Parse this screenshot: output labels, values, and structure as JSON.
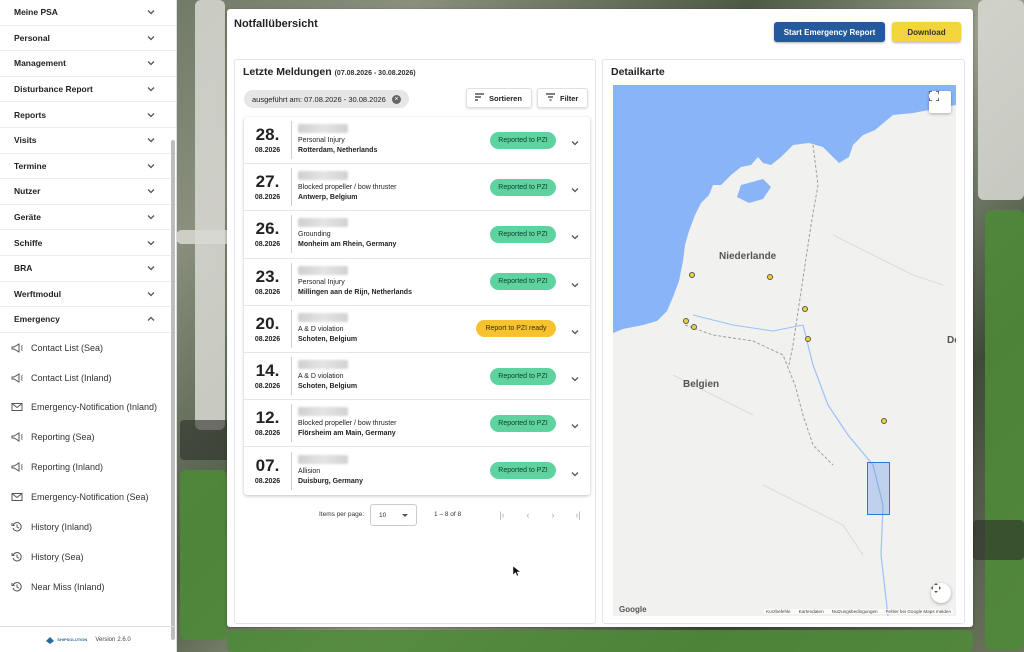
{
  "sidebar": {
    "sections": [
      {
        "label": "Meine PSA",
        "icon": "chevron-down-icon"
      },
      {
        "label": "Personal",
        "icon": "chevron-down-icon"
      },
      {
        "label": "Management",
        "icon": "chevron-down-icon"
      },
      {
        "label": "Disturbance Report",
        "icon": "chevron-down-icon"
      },
      {
        "label": "Reports",
        "icon": "chevron-down-icon"
      },
      {
        "label": "Visits",
        "icon": "chevron-down-icon"
      },
      {
        "label": "Termine",
        "icon": "chevron-down-icon"
      },
      {
        "label": "Nutzer",
        "icon": "chevron-down-icon"
      },
      {
        "label": "Geräte",
        "icon": "chevron-down-icon"
      },
      {
        "label": "Schiffe",
        "icon": "chevron-down-icon"
      },
      {
        "label": "BRA",
        "icon": "chevron-down-icon"
      },
      {
        "label": "Werftmodul",
        "icon": "chevron-down-icon"
      },
      {
        "label": "Emergency",
        "icon": "chevron-up-icon"
      }
    ],
    "emergency_items": [
      {
        "label": "Contact List (Sea)",
        "icon": "megaphone-icon"
      },
      {
        "label": "Contact List (Inland)",
        "icon": "megaphone-icon"
      },
      {
        "label": "Emergency-Notification (Inland)",
        "icon": "mail-icon"
      },
      {
        "label": "Reporting (Sea)",
        "icon": "megaphone-icon"
      },
      {
        "label": "Reporting (Inland)",
        "icon": "megaphone-icon"
      },
      {
        "label": "Emergency-Notification (Sea)",
        "icon": "mail-icon"
      },
      {
        "label": "History (Inland)",
        "icon": "history-icon"
      },
      {
        "label": "History (Sea)",
        "icon": "history-icon"
      },
      {
        "label": "Near Miss (Inland)",
        "icon": "history-icon"
      }
    ],
    "version_label": "Version",
    "version": "2.6.0",
    "logo_text": "SHIPSOLUTION"
  },
  "header": {
    "title": "Notfallübersicht",
    "start_button": "Start Emergency Report",
    "download_button": "Download"
  },
  "reports": {
    "title": "Letzte Meldungen",
    "range": "(07.08.2026 - 30.08.2026)",
    "chip": "ausgeführt am: 07.08.2026 - 30.08.2026",
    "sort_label": "Sortieren",
    "filter_label": "Filter",
    "rows": [
      {
        "day": "28.",
        "date": "08.2026",
        "incident": "Personal Injury",
        "location": "Rotterdam, Netherlands",
        "status": "Reported to PZI",
        "status_color": "#5ed3a0"
      },
      {
        "day": "27.",
        "date": "08.2026",
        "incident": "Blocked propeller / bow thruster",
        "location": "Antwerp, Belgium",
        "status": "Reported to PZI",
        "status_color": "#5ed3a0"
      },
      {
        "day": "26.",
        "date": "08.2026",
        "incident": "Grounding",
        "location": "Monheim am Rhein, Germany",
        "status": "Reported to PZI",
        "status_color": "#5ed3a0"
      },
      {
        "day": "23.",
        "date": "08.2026",
        "incident": "Personal Injury",
        "location": "Millingen aan de Rijn, Netherlands",
        "status": "Reported to PZI",
        "status_color": "#5ed3a0"
      },
      {
        "day": "20.",
        "date": "08.2026",
        "incident": "A & D violation",
        "location": "Schoten, Belgium",
        "status": "Report to PZI ready",
        "status_color": "#f6c230"
      },
      {
        "day": "14.",
        "date": "08.2026",
        "incident": "A & D violation",
        "location": "Schoten, Belgium",
        "status": "Reported to PZI",
        "status_color": "#5ed3a0"
      },
      {
        "day": "12.",
        "date": "08.2026",
        "incident": "Blocked propeller / bow thruster",
        "location": "Flörsheim am Main, Germany",
        "status": "Reported to PZI",
        "status_color": "#5ed3a0"
      },
      {
        "day": "07.",
        "date": "08.2026",
        "incident": "Allision",
        "location": "Duisburg, Germany",
        "status": "Reported to PZI",
        "status_color": "#5ed3a0"
      }
    ],
    "pager": {
      "items_per_page_label": "Items per page:",
      "items_per_page": "10",
      "range": "1 – 8 of 8"
    }
  },
  "map": {
    "title": "Detailkarte",
    "labels": {
      "netherlands": "Niederlande",
      "belgium": "Belgien",
      "germany_partial": "De"
    },
    "google": "Google",
    "footer_links": [
      "Kurzbefehle",
      "Kartendaten",
      "Nutzungsbedingungen",
      "Fehler bei Google Maps melden"
    ],
    "marker_color": "#f0d23a"
  }
}
